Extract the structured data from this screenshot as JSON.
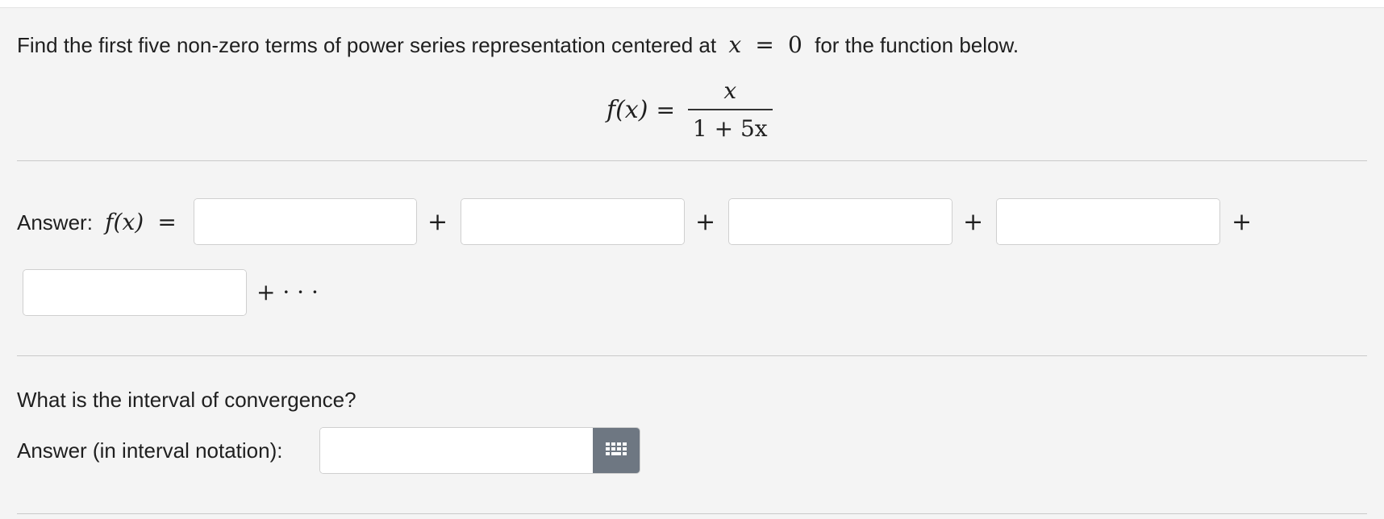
{
  "problem": {
    "prompt_pre": "Find the first five non-zero terms of power series representation centered at",
    "prompt_var": "x",
    "prompt_eq": "=",
    "prompt_val": "0",
    "prompt_post": "for the function below.",
    "formula_lhs": "f(x)",
    "formula_eq": "=",
    "formula_num": "x",
    "formula_den": "1 + 5x"
  },
  "answer1": {
    "label": "Answer:",
    "lhs": "f(x)",
    "eq": "=",
    "plus": "+",
    "ellipsis": "+ · · ·",
    "inputs": [
      {
        "value": "",
        "placeholder": ""
      },
      {
        "value": "",
        "placeholder": ""
      },
      {
        "value": "",
        "placeholder": ""
      },
      {
        "value": "",
        "placeholder": ""
      },
      {
        "value": "",
        "placeholder": ""
      }
    ],
    "keypad_icon": "grid-keypad-icon"
  },
  "question2": {
    "prompt": "What is the interval of convergence?",
    "label": "Answer (in interval notation):",
    "input": {
      "value": "",
      "placeholder": ""
    }
  },
  "colors": {
    "background": "#f4f4f4",
    "keypad_button": "#6e7782",
    "divider": "#c9c9c9"
  }
}
